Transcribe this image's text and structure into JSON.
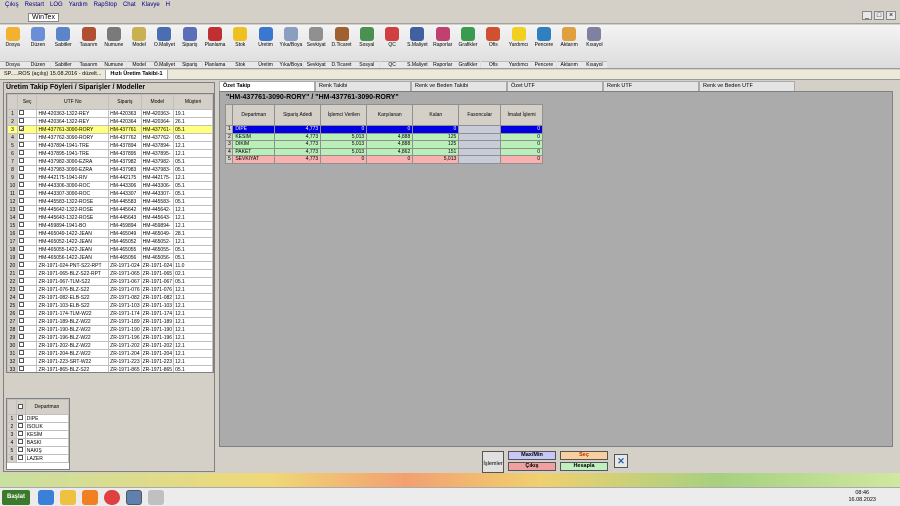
{
  "menu": [
    "Çıkış",
    "Restart",
    "LOG",
    "Yardım",
    "RapStop",
    "Chat",
    "Klavye",
    "H"
  ],
  "app_title": "WinTex",
  "toolbar": [
    {
      "label": "Dosya",
      "sub": "Dosya",
      "color": "#f3b12f"
    },
    {
      "label": "Düzen",
      "sub": "Düzen",
      "color": "#6b8fd6"
    },
    {
      "label": "Sabitler",
      "sub": "Sabitler",
      "color": "#5a85c8"
    },
    {
      "label": "Tasarım",
      "sub": "Tasarım",
      "color": "#b05030"
    },
    {
      "label": "Numune",
      "sub": "Numune",
      "color": "#7a7a7a"
    },
    {
      "label": "Model",
      "sub": "Model",
      "color": "#c9b050"
    },
    {
      "label": "Ö.Maliyet",
      "sub": "Ö.Maliyet",
      "color": "#4a6fb0"
    },
    {
      "label": "Sipariş",
      "sub": "Sipariş",
      "color": "#5a6fb8"
    },
    {
      "label": "Planlama",
      "sub": "Planlama",
      "color": "#c03030"
    },
    {
      "label": "Stok",
      "sub": "Stok",
      "color": "#f0c020"
    },
    {
      "label": "Üretim",
      "sub": "Üretim",
      "color": "#3a78d0"
    },
    {
      "label": "Yıka/Boya",
      "sub": "Yıka/Boya",
      "color": "#8a9fc0"
    },
    {
      "label": "Sevkiyat",
      "sub": "Sevkiyat",
      "color": "#909090"
    },
    {
      "label": "D.Ticaret",
      "sub": "D.Ticaret",
      "color": "#a06030"
    },
    {
      "label": "Sosyal",
      "sub": "Sosyal",
      "color": "#4a9050"
    },
    {
      "label": "QC",
      "sub": "QC",
      "color": "#d04040"
    },
    {
      "label": "S.Maliyet",
      "sub": "S.Maliyet",
      "color": "#4060a0"
    },
    {
      "label": "Raporlar",
      "sub": "Raporlar",
      "color": "#c04070"
    },
    {
      "label": "Grafikler",
      "sub": "Grafikler",
      "color": "#3a9a50"
    },
    {
      "label": "Ofis",
      "sub": "Ofis",
      "color": "#d05030"
    },
    {
      "label": "Yardımcı",
      "sub": "Yardımcı",
      "color": "#f2d020"
    },
    {
      "label": "Pencere",
      "sub": "Pencere",
      "color": "#3080c0"
    },
    {
      "label": "Aktarım",
      "sub": "Aktarım",
      "color": "#e0a040"
    },
    {
      "label": "Kısayol",
      "sub": "Kısayol",
      "color": "#8080a0"
    }
  ],
  "doc_tabs": [
    "SP.....ROS (açılış) 15.08.2016 - düzelt...",
    "Hızlı Üretim Takibi-1"
  ],
  "left": {
    "title": "Üretim Takip Föyleri / Siparişler / Modeller",
    "columns": [
      "Seç",
      "UTF No",
      "Sipariş",
      "Model",
      "Müşteri"
    ],
    "rows": [
      {
        "n": "1",
        "utf": "HM-420363-1322-REY",
        "sip": "HM-420363",
        "model": "HM-420363-",
        "mus": "19.1"
      },
      {
        "n": "2",
        "utf": "HM-420364-1322-REY",
        "sip": "HM-420364",
        "model": "HM-420364-",
        "mus": "26.1"
      },
      {
        "n": "3",
        "utf": "HM-437761-3090-RORY",
        "sip": "HM-437761",
        "model": "HM-437761-",
        "mus": "05.1"
      },
      {
        "n": "4",
        "utf": "HM-437762-3090-RORY",
        "sip": "HM-437762",
        "model": "HM-437762-",
        "mus": "05.1"
      },
      {
        "n": "5",
        "utf": "HM-437894-1941-TRE",
        "sip": "HM-437894",
        "model": "HM-437894-",
        "mus": "12.1"
      },
      {
        "n": "6",
        "utf": "HM-437895-1941-TRE",
        "sip": "HM-437895",
        "model": "HM-437895-",
        "mus": "12.1"
      },
      {
        "n": "7",
        "utf": "HM-437982-3090-EZRA",
        "sip": "HM-437982",
        "model": "HM-437982-",
        "mus": "05.1"
      },
      {
        "n": "8",
        "utf": "HM-437983-3090-EZRA",
        "sip": "HM-437983",
        "model": "HM-437983-",
        "mus": "05.1"
      },
      {
        "n": "9",
        "utf": "HM-442175-1941-RIV",
        "sip": "HM-442175",
        "model": "HM-442175-",
        "mus": "12.1"
      },
      {
        "n": "10",
        "utf": "HM-443306-3090-ROC",
        "sip": "HM-443306",
        "model": "HM-443306-",
        "mus": "05.1"
      },
      {
        "n": "11",
        "utf": "HM-443307-3090-ROC",
        "sip": "HM-443307",
        "model": "HM-443307-",
        "mus": "05.1"
      },
      {
        "n": "12",
        "utf": "HM-445583-1322-ROSE",
        "sip": "HM-445583",
        "model": "HM-445583-",
        "mus": "05.1"
      },
      {
        "n": "13",
        "utf": "HM-445642-1322-ROSE",
        "sip": "HM-445642",
        "model": "HM-445642-",
        "mus": "12.1"
      },
      {
        "n": "14",
        "utf": "HM-445643-1322-ROSE",
        "sip": "HM-445643",
        "model": "HM-445643-",
        "mus": "12.1"
      },
      {
        "n": "15",
        "utf": "HM-459894-1941-BO",
        "sip": "HM-459894",
        "model": "HM-459894-",
        "mus": "12.1"
      },
      {
        "n": "16",
        "utf": "HM-465049-1422-JEAN",
        "sip": "HM-465049",
        "model": "HM-465049-",
        "mus": "28.1"
      },
      {
        "n": "17",
        "utf": "HM-465052-1422-JEAN",
        "sip": "HM-465052",
        "model": "HM-465052-",
        "mus": "12.1"
      },
      {
        "n": "18",
        "utf": "HM-465055-1422-JEAN",
        "sip": "HM-465055",
        "model": "HM-465055-",
        "mus": "05.1"
      },
      {
        "n": "19",
        "utf": "HM-465056-1422-JEAN",
        "sip": "HM-465056",
        "model": "HM-465056-",
        "mus": "05.1"
      },
      {
        "n": "20",
        "utf": "ZR-1971-024-PNT-S22-RPT",
        "sip": "ZR-1971-024",
        "model": "ZR-1971-024",
        "mus": "11.0"
      },
      {
        "n": "21",
        "utf": "ZR-1971-065-BLZ-S22-RPT",
        "sip": "ZR-1971-065",
        "model": "ZR-1971-065",
        "mus": "02.1"
      },
      {
        "n": "22",
        "utf": "ZR-1971-067-TLM-S22",
        "sip": "ZR-1971-067",
        "model": "ZR-1971-067",
        "mus": "05.1"
      },
      {
        "n": "23",
        "utf": "ZR-1971-076-BLZ-S22",
        "sip": "ZR-1971-076",
        "model": "ZR-1971-076",
        "mus": "12.1"
      },
      {
        "n": "24",
        "utf": "ZR-1971-082-ELB-S22",
        "sip": "ZR-1971-082",
        "model": "ZR-1971-082",
        "mus": "12.1"
      },
      {
        "n": "25",
        "utf": "ZR-1971-103-ELB-S22",
        "sip": "ZR-1971-103",
        "model": "ZR-1971-103",
        "mus": "12.1"
      },
      {
        "n": "26",
        "utf": "ZR-1971-174-TLM-W22",
        "sip": "ZR-1971-174",
        "model": "ZR-1971-174",
        "mus": "12.1"
      },
      {
        "n": "27",
        "utf": "ZR-1971-189-BLZ-W22",
        "sip": "ZR-1971-189",
        "model": "ZR-1971-189",
        "mus": "12.1"
      },
      {
        "n": "28",
        "utf": "ZR-1971-190-BLZ-W22",
        "sip": "ZR-1971-190",
        "model": "ZR-1971-190",
        "mus": "12.1"
      },
      {
        "n": "29",
        "utf": "ZR-1971-196-BLZ-W22",
        "sip": "ZR-1971-196",
        "model": "ZR-1971-196",
        "mus": "12.1"
      },
      {
        "n": "30",
        "utf": "ZR-1971-202-BLZ-W22",
        "sip": "ZR-1971-202",
        "model": "ZR-1971-202",
        "mus": "12.1"
      },
      {
        "n": "31",
        "utf": "ZR-1971-204-BLZ-W22",
        "sip": "ZR-1971-204",
        "model": "ZR-1971-204",
        "mus": "12.1"
      },
      {
        "n": "32",
        "utf": "ZR-1971-223-SRT-W22",
        "sip": "ZR-1971-223",
        "model": "ZR-1971-223",
        "mus": "12.1"
      },
      {
        "n": "33",
        "utf": "ZR-1971-865-BLZ-S22",
        "sip": "ZR-1971-865",
        "model": "ZR-1971-865",
        "mus": "05.1"
      },
      {
        "n": "34",
        "utf": "ZR-2022-2334-KEMER-W22",
        "sip": "ZR-2022-23",
        "model": "ZR-2022-23",
        "mus": "05.1"
      }
    ],
    "dept_header": "Departman",
    "dept_rows": [
      {
        "n": "1",
        "name": "DIPE"
      },
      {
        "n": "2",
        "name": "ISOLIK"
      },
      {
        "n": "3",
        "name": "KESİM"
      },
      {
        "n": "4",
        "name": "BASKI"
      },
      {
        "n": "5",
        "name": "NAKIŞ"
      },
      {
        "n": "6",
        "name": "LAZER"
      }
    ]
  },
  "right_tabs": [
    "Özet Takip",
    "Renk Takibi",
    "Renk ve Beden Takibi",
    "Özet UTF",
    "Renk UTF",
    "Renk ve Beden UTF"
  ],
  "right": {
    "header": "\"HM-437761-3090-RORY\" / \"HM-437761-3090-RORY\"",
    "columns": [
      "Departman",
      "Sipariş Adedi",
      "İşlemci Verilen",
      "Karşılanan",
      "Kalan",
      "Fasoncular",
      "İmalat İşlemi"
    ],
    "rows": [
      {
        "n": "1",
        "dept": "DIPE",
        "sip": "4,773",
        "isl": "0",
        "kar": "0",
        "kal": "0",
        "faso": "",
        "ima": "0",
        "color": "#0000e0"
      },
      {
        "n": "2",
        "dept": "KESİM",
        "sip": "4,773",
        "isl": "5,013",
        "kar": "4,888",
        "kal": "125",
        "faso": "",
        "ima": "0",
        "color": "#b8f0b8"
      },
      {
        "n": "3",
        "dept": "DİKİM",
        "sip": "4,773",
        "isl": "5,013",
        "kar": "4,888",
        "kal": "125",
        "faso": "",
        "ima": "0",
        "color": "#b8f0b8"
      },
      {
        "n": "4",
        "dept": "PAKET",
        "sip": "4,773",
        "isl": "5,013",
        "kar": "4,862",
        "kal": "151",
        "faso": "",
        "ima": "0",
        "color": "#b8f0b8"
      },
      {
        "n": "5",
        "dept": "SEVKİYAT",
        "sip": "4,773",
        "isl": "0",
        "kar": "0",
        "kal": "5,013",
        "faso": "",
        "ima": "0",
        "color": "#f8b0b0"
      }
    ]
  },
  "buttons": {
    "islemler": "İşlemler",
    "maxmin": "Max/Min",
    "sec": "Seç",
    "cikis": "Çıkış",
    "hesapla": "Hesapla"
  },
  "taskbar": {
    "start": "Başlat",
    "time": "08:46",
    "date": "16.08.2023"
  }
}
